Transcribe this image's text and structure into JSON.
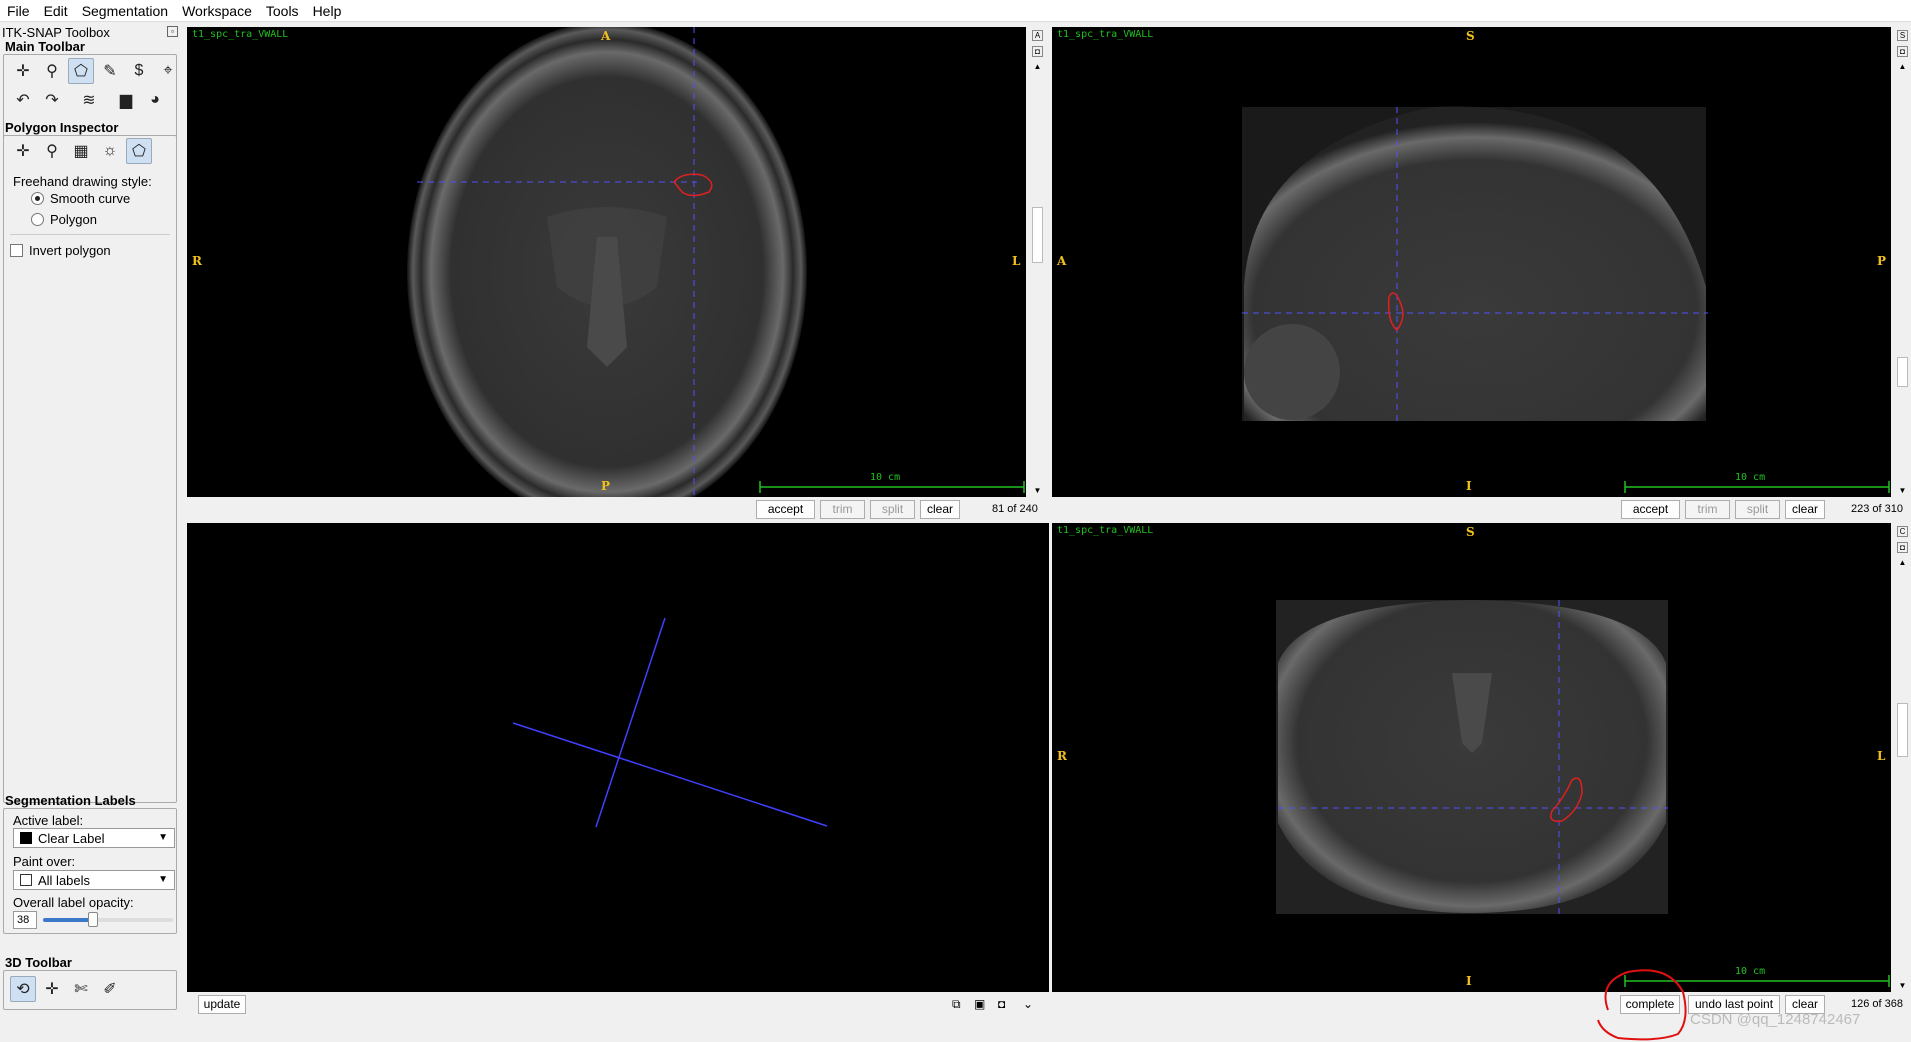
{
  "menubar": [
    "File",
    "Edit",
    "Segmentation",
    "Workspace",
    "Tools",
    "Help"
  ],
  "toolbox": {
    "title": "ITK-SNAP Toolbox",
    "main_toolbar_heading": "Main Toolbar",
    "polygon_inspector_heading": "Polygon Inspector",
    "freehand_label": "Freehand drawing style:",
    "smooth_curve": "Smooth curve",
    "polygon": "Polygon",
    "invert_polygon": "Invert polygon",
    "seg_labels_heading": "Segmentation Labels",
    "active_label_caption": "Active label:",
    "active_label_value": "Clear Label",
    "paint_over_caption": "Paint over:",
    "paint_over_value": "All labels",
    "opacity_caption": "Overall label opacity:",
    "opacity_value": "38",
    "toolbar_3d_heading": "3D Toolbar"
  },
  "views": {
    "axial": {
      "title": "t1_spc_tra_VWALL",
      "top": "A",
      "bottom": "P",
      "left": "R",
      "right": "L",
      "scale": "10 cm",
      "accept": "accept",
      "trim": "trim",
      "split": "split",
      "clear": "clear",
      "slice": "81 of 240"
    },
    "sagittal": {
      "title": "t1_spc_tra_VWALL",
      "top": "S",
      "bottom": "I",
      "left": "A",
      "right": "P",
      "scale": "10 cm",
      "accept": "accept",
      "trim": "trim",
      "split": "split",
      "clear": "clear",
      "slice": "223 of 310"
    },
    "render3d": {
      "update": "update"
    },
    "coronal": {
      "title": "t1_spc_tra_VWALL",
      "top": "S",
      "bottom": "I",
      "left": "R",
      "right": "L",
      "scale": "10 cm",
      "complete": "complete",
      "undo": "undo last point",
      "clear": "clear",
      "slice": "126 of 368"
    }
  },
  "watermark": "CSDN @qq_1248742467",
  "colors": {
    "accent": "#3c78c8",
    "crosshair": "#5050ff",
    "contour": "#e02020",
    "scalebar": "#22c022",
    "orient": "#f0c020"
  }
}
